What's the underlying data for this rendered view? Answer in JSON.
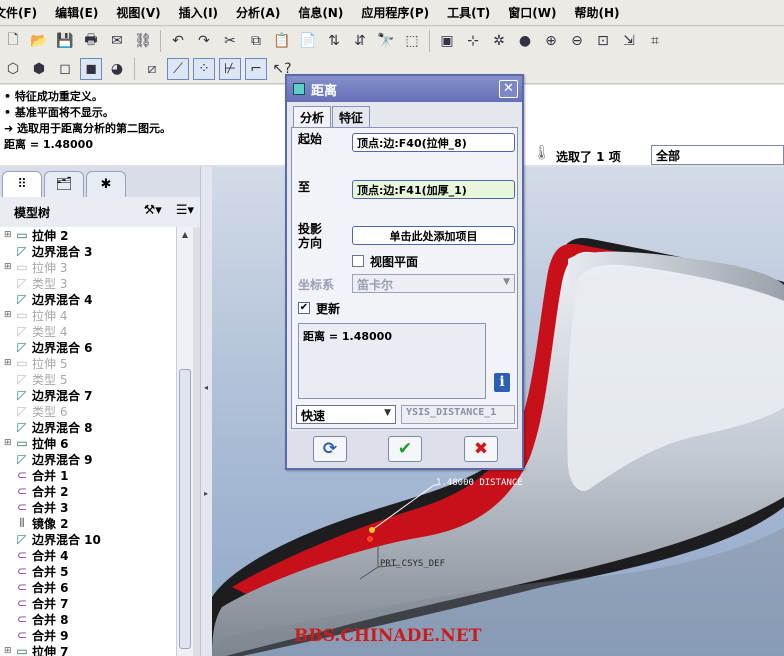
{
  "menu": [
    "文件(F)",
    "编辑(E)",
    "视图(V)",
    "插入(I)",
    "分析(A)",
    "信息(N)",
    "应用程序(P)",
    "工具(T)",
    "窗口(W)",
    "帮助(H)"
  ],
  "messages": [
    "• 特征成功重定义。",
    "• 基准平面将不显示。",
    "➜ 选取用于距离分析的第二图元。",
    "距离 = 1.48000"
  ],
  "selection": {
    "count_label": "选取了 1 项",
    "filter_value": "全部"
  },
  "model_tree": {
    "title": "模型树",
    "items": [
      {
        "label": "拉伸 2",
        "dim": false,
        "icon": "extrude-icon"
      },
      {
        "label": "边界混合 3",
        "dim": false,
        "icon": "blend-icon"
      },
      {
        "label": "拉伸 3",
        "dim": true,
        "icon": "extrude-icon"
      },
      {
        "label": "类型 3",
        "dim": true,
        "icon": "blend-icon"
      },
      {
        "label": "边界混合 4",
        "dim": false,
        "icon": "blend-icon"
      },
      {
        "label": "拉伸 4",
        "dim": true,
        "icon": "extrude-icon"
      },
      {
        "label": "类型 4",
        "dim": true,
        "icon": "blend-icon"
      },
      {
        "label": "边界混合 6",
        "dim": false,
        "icon": "blend-icon"
      },
      {
        "label": "拉伸 5",
        "dim": true,
        "icon": "extrude-icon"
      },
      {
        "label": "类型 5",
        "dim": true,
        "icon": "blend-icon"
      },
      {
        "label": "边界混合 7",
        "dim": false,
        "icon": "blend-icon"
      },
      {
        "label": "类型 6",
        "dim": true,
        "icon": "blend-icon"
      },
      {
        "label": "边界混合 8",
        "dim": false,
        "icon": "blend-icon"
      },
      {
        "label": "拉伸 6",
        "dim": false,
        "icon": "extrude-icon"
      },
      {
        "label": "边界混合 9",
        "dim": false,
        "icon": "blend-icon"
      },
      {
        "label": "合并 1",
        "dim": false,
        "icon": "merge-icon"
      },
      {
        "label": "合并 2",
        "dim": false,
        "icon": "merge-icon"
      },
      {
        "label": "合并 3",
        "dim": false,
        "icon": "merge-icon"
      },
      {
        "label": "镜像 2",
        "dim": false,
        "icon": "mirror-icon"
      },
      {
        "label": "边界混合 10",
        "dim": false,
        "icon": "blend-icon"
      },
      {
        "label": "合并 4",
        "dim": false,
        "icon": "merge-icon"
      },
      {
        "label": "合并 5",
        "dim": false,
        "icon": "merge-icon"
      },
      {
        "label": "合并 6",
        "dim": false,
        "icon": "merge-icon"
      },
      {
        "label": "合并 7",
        "dim": false,
        "icon": "merge-icon"
      },
      {
        "label": "合并 8",
        "dim": false,
        "icon": "merge-icon"
      },
      {
        "label": "合并 9",
        "dim": false,
        "icon": "merge-icon"
      },
      {
        "label": "拉伸 7",
        "dim": false,
        "icon": "extrude-icon"
      }
    ]
  },
  "dialog": {
    "title": "距离",
    "tabs": [
      "分析",
      "特征"
    ],
    "from_label": "起始",
    "from_value": "顶点:边:F40(拉伸_8)",
    "to_label": "至",
    "to_value": "顶点:边:F41(加厚_1)",
    "projection_label_1": "投影",
    "projection_label_2": "方向",
    "projection_value": "单击此处添加项目",
    "view_plane_label": "视图平面",
    "csys_label": "坐标系",
    "csys_value": "笛卡尔",
    "update_label": "更新",
    "result_text": "距离 = 1.48000",
    "mode_value": "快速",
    "name_value": "YSIS_DISTANCE_1"
  },
  "viewport": {
    "distance_annotation": "1.48000  DISTANCE",
    "csys_label": "PRT_CSYS_DEF",
    "watermark": "BBS.CHINADE.NET"
  },
  "colors": {
    "accent": "#5b6aa9",
    "model_red": "#c8101a",
    "model_gray": "#9aa2aa"
  }
}
